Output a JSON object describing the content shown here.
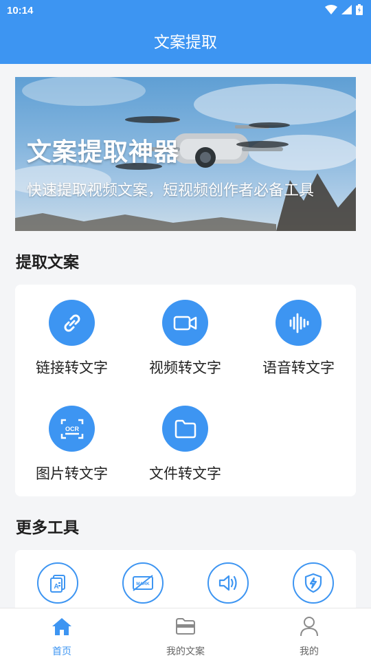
{
  "status_bar": {
    "time": "10:14"
  },
  "app_bar": {
    "title": "文案提取"
  },
  "banner": {
    "title": "文案提取神器",
    "subtitle": "快速提取视频文案，短视频创作者必备工具"
  },
  "extract_section": {
    "title": "提取文案",
    "tools": [
      {
        "label": "链接转文字",
        "icon": "link-icon"
      },
      {
        "label": "视频转文字",
        "icon": "video-camera-icon"
      },
      {
        "label": "语音转文字",
        "icon": "waveform-icon"
      },
      {
        "label": "图片转文字",
        "icon": "ocr-scan-icon",
        "icon_text": "OCR"
      },
      {
        "label": "文件转文字",
        "icon": "folder-icon"
      }
    ]
  },
  "more_section": {
    "title": "更多工具",
    "tools": [
      {
        "icon": "document-text-icon"
      },
      {
        "icon": "watermark-remove-icon",
        "icon_text": "MARK"
      },
      {
        "icon": "speaker-icon"
      },
      {
        "icon": "shield-icon"
      }
    ]
  },
  "bottom_nav": {
    "items": [
      {
        "label": "首页",
        "icon": "home-icon",
        "active": true
      },
      {
        "label": "我的文案",
        "icon": "folder-icon",
        "active": false
      },
      {
        "label": "我的",
        "icon": "user-icon",
        "active": false
      }
    ]
  },
  "colors": {
    "primary": "#3d95f2",
    "background": "#f4f5f7",
    "card": "#ffffff"
  }
}
